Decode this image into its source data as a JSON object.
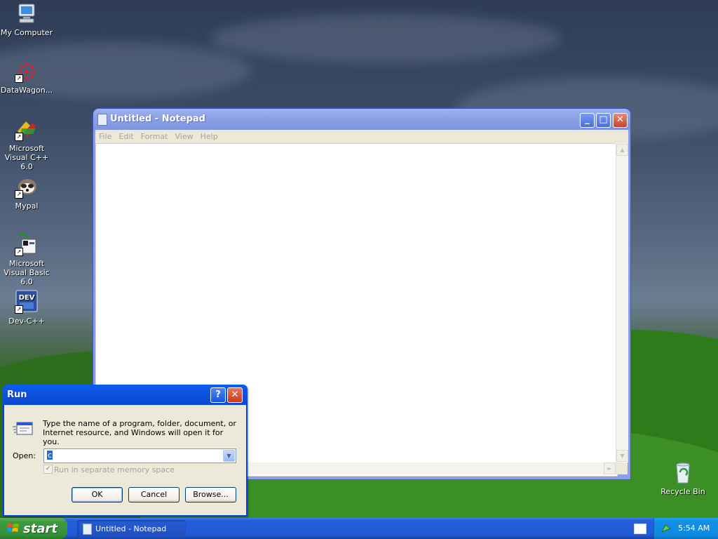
{
  "desktop": {
    "icons": [
      {
        "label": "My Computer"
      },
      {
        "label": "DataWagon..."
      },
      {
        "label": "Microsoft Visual C++ 6.0"
      },
      {
        "label": "Mypal"
      },
      {
        "label": "Microsoft Visual Basic 6.0"
      },
      {
        "label": "Dev-C++"
      },
      {
        "label": "Recycle Bin"
      }
    ]
  },
  "notepad": {
    "title": "Untitled - Notepad",
    "menu": [
      "File",
      "Edit",
      "Format",
      "View",
      "Help"
    ],
    "content": "",
    "controls": {
      "minimize": "_",
      "maximize": "□",
      "close": "✕"
    }
  },
  "run_dialog": {
    "title": "Run",
    "description": "Type the name of a program, folder, document, or Internet resource, and Windows will open it for you.",
    "open_label": "Open:",
    "open_value": "c",
    "checkbox_label": "Run in separate memory space",
    "checkbox_checked": true,
    "buttons": {
      "ok": "OK",
      "cancel": "Cancel",
      "browse": "Browse..."
    },
    "help_glyph": "?",
    "close_glyph": "✕"
  },
  "taskbar": {
    "start_label": "start",
    "tasks": [
      {
        "label": "Untitled - Notepad"
      }
    ],
    "clock": "5:54 AM"
  },
  "colors": {
    "xp_blue": "#0a5cf0",
    "start_green": "#3c9a3c",
    "tray_blue": "#0f8ae0",
    "dialog_face": "#ece9d8"
  }
}
